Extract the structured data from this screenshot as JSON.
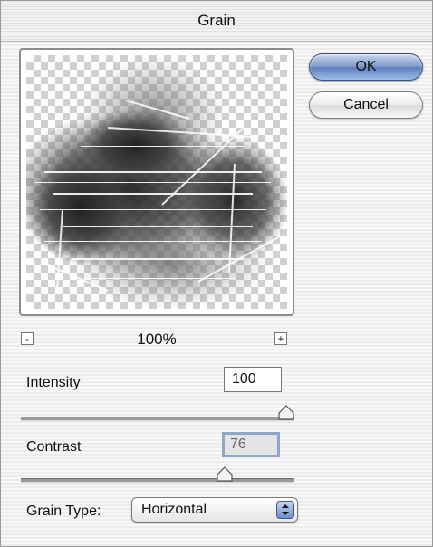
{
  "window": {
    "title": "Grain"
  },
  "preview": {
    "zoom_out_symbol": "-",
    "zoom_in_symbol": "+",
    "zoom_level": "100%"
  },
  "buttons": {
    "ok_label": "OK",
    "cancel_label": "Cancel"
  },
  "intensity": {
    "label": "Intensity",
    "value": "100",
    "slider_fraction": 1.0
  },
  "contrast": {
    "label": "Contrast",
    "value": "76",
    "slider_fraction": 0.76
  },
  "grain_type": {
    "label": "Grain Type:",
    "selected": "Horizontal"
  },
  "colors": {
    "ok_button": "#7f9ccc",
    "slider_thumb": "#f2f2f2"
  },
  "icons": {
    "zoom_out": "minus-icon",
    "zoom_in": "plus-icon",
    "select_arrows": "updown-arrows-icon"
  }
}
